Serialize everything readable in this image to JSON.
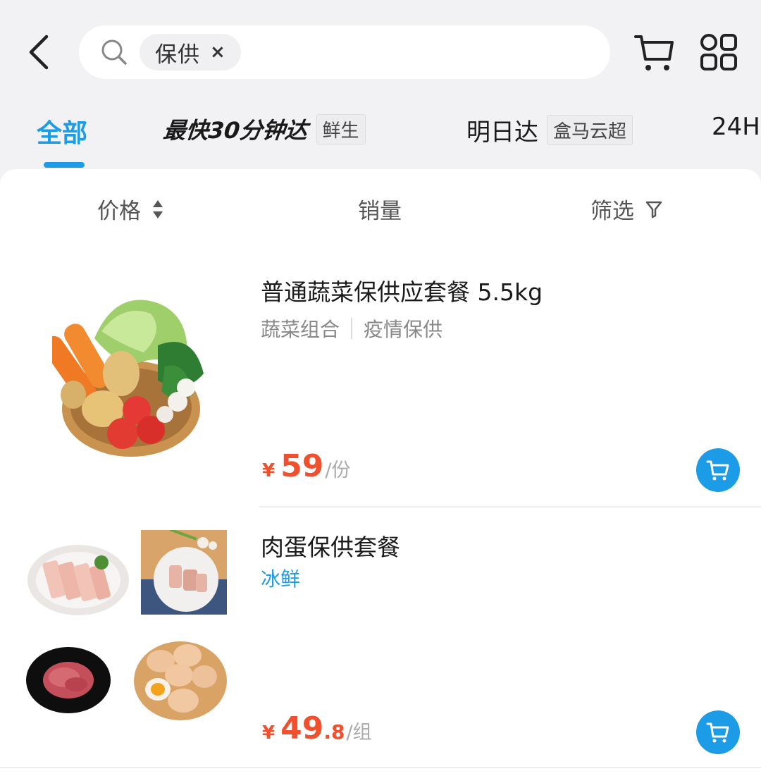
{
  "colors": {
    "accent": "#1c9be6",
    "price": "#f0502d",
    "background": "#f2f2f4"
  },
  "search": {
    "chip_text": "保供",
    "chip_close": "×"
  },
  "header_icons": {
    "back": "chevron-left-icon",
    "search": "search-icon",
    "cart": "cart-icon",
    "menu": "grid-icon"
  },
  "tabs": {
    "all": "全部",
    "fast": {
      "title": "最快30分钟达",
      "tag": "鲜生"
    },
    "tomorrow": {
      "title": "明日达",
      "tag": "盒马云超"
    },
    "h24": "24H"
  },
  "sort": {
    "price": "价格",
    "sales": "销量",
    "filter": "筛选"
  },
  "products": [
    {
      "title": "普通蔬菜保供应套餐 5.5kg",
      "tags": [
        "蔬菜组合",
        "疫情保供"
      ],
      "price": {
        "currency": "¥",
        "integer": "59",
        "decimal": "",
        "unit": "/份"
      }
    },
    {
      "title": "肉蛋保供套餐",
      "badge": "冰鲜",
      "price": {
        "currency": "¥",
        "integer": "49",
        "decimal": ".8",
        "unit": "/组"
      }
    }
  ]
}
